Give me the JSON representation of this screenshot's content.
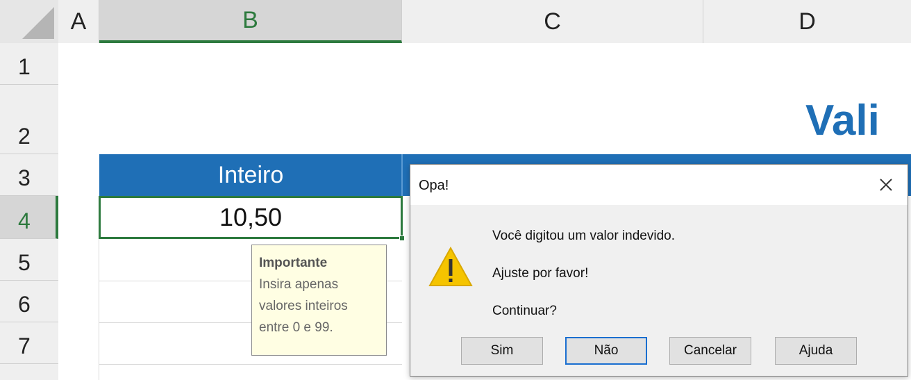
{
  "columns": [
    "A",
    "B",
    "C",
    "D"
  ],
  "rows": [
    "1",
    "2",
    "3",
    "4",
    "5",
    "6",
    "7"
  ],
  "sheet": {
    "title": "Vali",
    "header_cell": "Inteiro",
    "active_cell_value": "10,50"
  },
  "tooltip": {
    "title": "Importante",
    "lines": [
      "Insira apenas",
      "valores inteiros",
      "entre 0 e 99."
    ]
  },
  "dialog": {
    "title": "Opa!",
    "messages": [
      "Você digitou um valor indevido.",
      "Ajuste por favor!",
      "Continuar?"
    ],
    "buttons": [
      "Sim",
      "Não",
      "Cancelar",
      "Ajuda"
    ],
    "icon": "warning-icon"
  },
  "colors": {
    "accent_green": "#2d7a3e",
    "header_blue": "#1f6fb6",
    "tooltip_bg": "#fffee3"
  }
}
